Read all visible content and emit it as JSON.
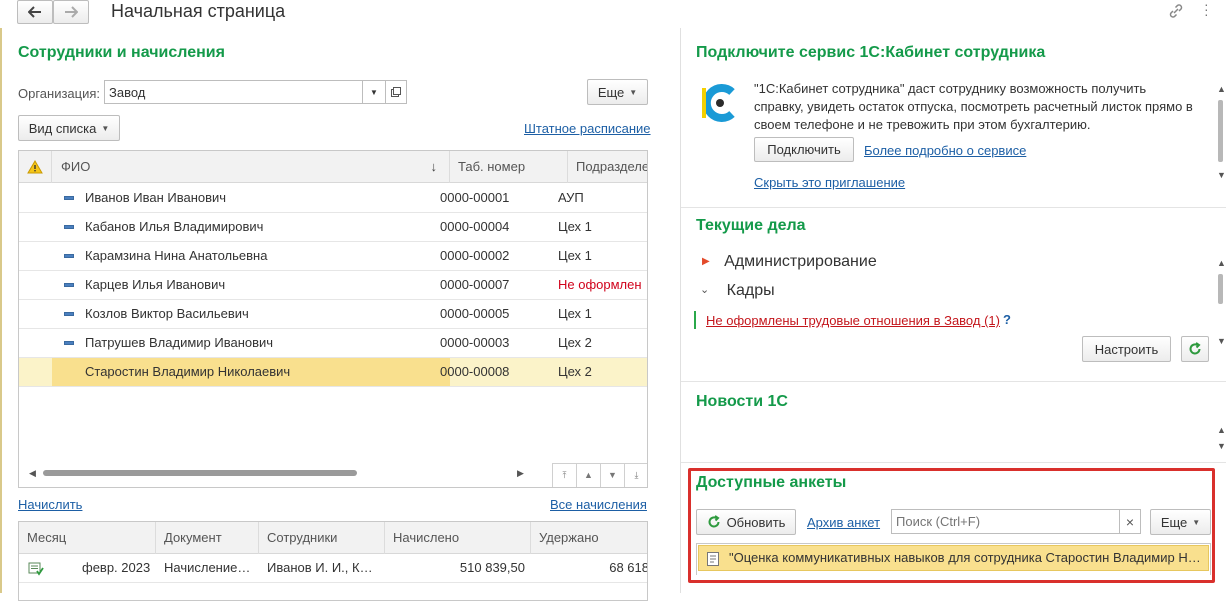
{
  "header": {
    "title": "Начальная страница",
    "back_icon": "arrow-left-icon",
    "forward_icon": "arrow-right-icon",
    "link_icon": "chain-link-icon",
    "more_icon": "vertical-dots-icon"
  },
  "employees": {
    "title": "Сотрудники и начисления",
    "org_label": "Организация:",
    "org_value": "Завод",
    "more_button": "Еще",
    "view_button": "Вид списка",
    "staff_link": "Штатное расписание",
    "columns": [
      "ФИО",
      "Таб. номер",
      "Подразделение"
    ],
    "rows": [
      {
        "name": "Иванов Иван Иванович",
        "num": "0000-00001",
        "dept": "АУП",
        "alert": false
      },
      {
        "name": "Кабанов Илья Владимирович",
        "num": "0000-00004",
        "dept": "Цех 1",
        "alert": false
      },
      {
        "name": "Карамзина Нина Анатольевна",
        "num": "0000-00002",
        "dept": "Цех 1",
        "alert": false
      },
      {
        "name": "Карцев Илья Иванович",
        "num": "0000-00007",
        "dept": "Не оформлен",
        "alert": true
      },
      {
        "name": "Козлов Виктор Васильевич",
        "num": "0000-00005",
        "dept": "Цех 1",
        "alert": false
      },
      {
        "name": "Патрушев Владимир Иванович",
        "num": "0000-00003",
        "dept": "Цех 2",
        "alert": false
      },
      {
        "name": "Старостин Владимир Николаевич",
        "num": "0000-00008",
        "dept": "Цех 2",
        "alert": false
      }
    ],
    "selected_row": 6
  },
  "accruals": {
    "accrue_link": "Начислить",
    "all_link": "Все начисления",
    "columns": [
      "Месяц",
      "Документ",
      "Сотрудники",
      "Начислено",
      "Удержано"
    ],
    "rows": [
      {
        "month": "февр. 2023",
        "doc": "Начисление…",
        "staff": "Иванов И. И., К…",
        "accrued": "510 839,50",
        "withheld": "68 618"
      }
    ]
  },
  "cabinet": {
    "title": "Подключите сервис 1С:Кабинет сотрудника",
    "text": "\"1С:Кабинет сотрудника\" даст сотруднику возможность получить справку, увидеть остаток отпуска, посмотреть расчетный листок прямо в своем телефоне и не тревожить при этом бухгалтерию.",
    "connect_button": "Подключить",
    "more_link": "Более подробно о сервисе",
    "hide_link": "Скрыть это приглашение"
  },
  "tasks": {
    "title": "Текущие дела",
    "items": [
      "Администрирование",
      "Кадры"
    ],
    "alert_link": "Не оформлены трудовые отношения в Завод (1)",
    "help": "?",
    "configure_button": "Настроить"
  },
  "news": {
    "title": "Новости 1С"
  },
  "surveys": {
    "title": "Доступные анкеты",
    "refresh_button": "Обновить",
    "archive_link": "Архив анкет",
    "search_placeholder": "Поиск (Ctrl+F)",
    "clear": "×",
    "more_button": "Еще",
    "item": "\"Оценка коммуникативных навыков для сотрудника Старостин Владимир Н…"
  },
  "colors": {
    "accent_green": "#149a4a",
    "link_blue": "#1d5fa5",
    "alert_red": "#d0021b",
    "selection": "#f9e08e",
    "highlight_border": "#d9302c"
  }
}
